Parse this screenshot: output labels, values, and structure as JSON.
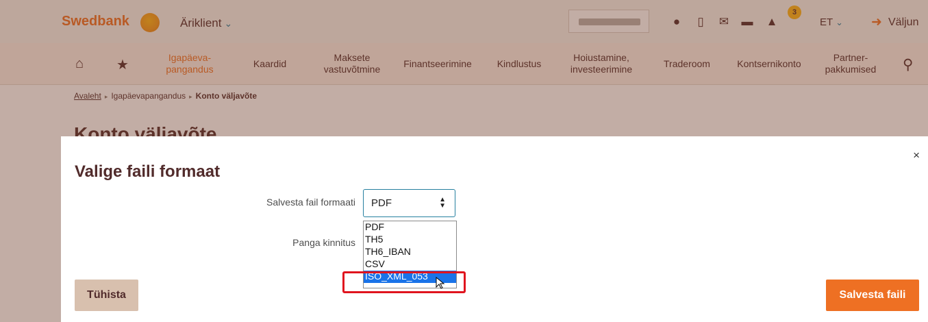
{
  "header": {
    "brand": "Swedbank",
    "client_menu": "Äriklient",
    "notification_count": "3",
    "language": "ET",
    "logout": "Väljun"
  },
  "nav": {
    "items": [
      {
        "label": "Igapäeva-\npangandus",
        "active": true
      },
      {
        "label": "Kaardid"
      },
      {
        "label": "Maksete\nvastuvõtmine"
      },
      {
        "label": "Finantseerimine"
      },
      {
        "label": "Kindlustus"
      },
      {
        "label": "Hoiustamine,\ninvesteerimine"
      },
      {
        "label": "Traderoom"
      },
      {
        "label": "Kontsernikonto"
      },
      {
        "label": "Partner-\npakkumised"
      }
    ]
  },
  "breadcrumb": {
    "home": "Avaleht",
    "section": "Igapäevapangandus",
    "current": "Konto väljavõte"
  },
  "page_title": "Konto väljavõte",
  "modal": {
    "title": "Valige faili formaat",
    "format_label": "Salvesta fail formaati",
    "format_value": "PDF",
    "bank_confirmation_label": "Panga kinnitus",
    "format_options": [
      "PDF",
      "TH5",
      "TH6_IBAN",
      "CSV",
      "ISO_XML_053"
    ],
    "highlighted_option": "ISO_XML_053",
    "cancel_label": "Tühista",
    "save_label": "Salvesta faili",
    "close_symbol": "×"
  },
  "colors": {
    "brand_orange": "#ee7023",
    "brand_brown": "#512b2b",
    "select_highlight": "#1a73e8",
    "annotation_red": "#e0141e"
  }
}
